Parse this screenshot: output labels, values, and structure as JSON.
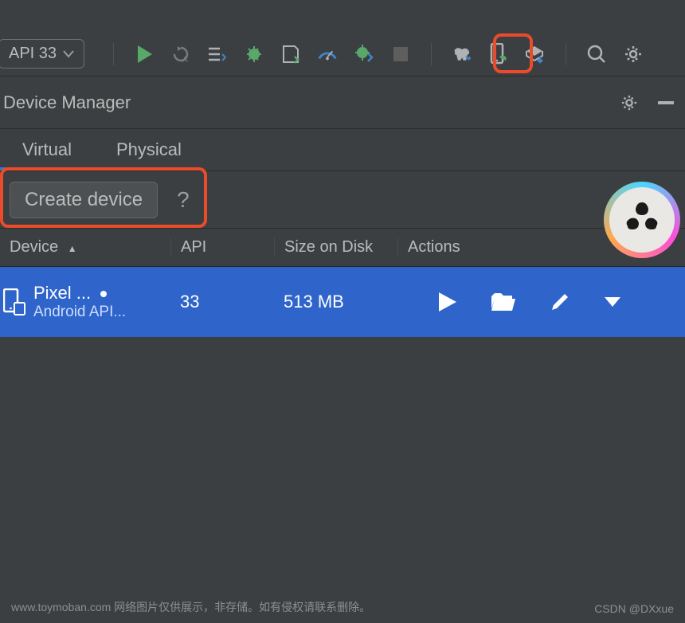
{
  "toolbar": {
    "api_dropdown": "API 33"
  },
  "panel": {
    "title": "Device Manager"
  },
  "tabs": {
    "virtual": "Virtual",
    "physical": "Physical"
  },
  "buttons": {
    "create_device": "Create device"
  },
  "help_symbol": "?",
  "table": {
    "headers": {
      "device": "Device",
      "api": "API",
      "size": "Size on Disk",
      "actions": "Actions"
    }
  },
  "rows": [
    {
      "name": "Pixel ...",
      "subtitle": "Android API...",
      "api": "33",
      "size": "513 MB"
    }
  ],
  "footer": "www.toymoban.com 网络图片仅供展示，非存储。如有侵权请联系删除。",
  "watermark": "CSDN @DXxue"
}
